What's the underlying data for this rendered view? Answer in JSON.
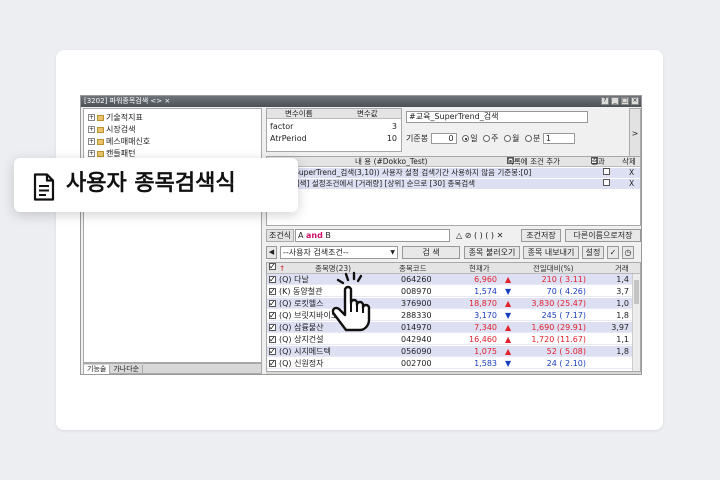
{
  "window": {
    "title": "[3202] 파워종목검색 <> ×"
  },
  "tree": [
    "기술적지표",
    "시장검색",
    "메스매매신호",
    "캔들패턴"
  ],
  "left_tabs": [
    "기능술",
    "가나다순"
  ],
  "variables": {
    "headers": [
      "변수이름",
      "변수값"
    ],
    "rows": [
      {
        "name": "factor",
        "value": "3"
      },
      {
        "name": "AtrPeriod",
        "value": "10"
      }
    ]
  },
  "formula_name": "#교육_SuperTrend_검색",
  "period": {
    "label": "기준봉",
    "value": "0",
    "options": [
      "일",
      "주",
      "월",
      "분"
    ],
    "selected": "일",
    "minute_value": "1"
  },
  "side_button": ">",
  "condition_grid": {
    "headers": [
      "내 용 (#Dokko_Test)",
      "목록에 조건 추가",
      "결과",
      "삭제"
    ],
    "rows": [
      {
        "text": "A 교육_SuperTrend_검색(3,10)) 사용자 설정 검색기간 사용하지 않음 기준봉:[0]",
        "del": "X"
      },
      {
        "text": "B 순위 검색] 설정조건에서 [거래량] [상위] 순으로 [30] 종목검색",
        "del": "X"
      }
    ]
  },
  "formula_row": {
    "label": "조건식",
    "parts": [
      "A",
      "and",
      "B"
    ],
    "symbols": "△ ⊘ ( ) ( ) ✕",
    "save_label": "조건저장",
    "save_as_label": "다른이름으로저장"
  },
  "search_row": {
    "dropdown": "--사용자 검색조건--",
    "search_label": "검  색",
    "load_label": "종목 불러오기",
    "export_label": "종목 내보내기",
    "settings_label": "설정"
  },
  "results": {
    "headers": [
      "종목명(23)",
      "종목코드",
      "현재가",
      "전일대비(%)",
      "거래"
    ],
    "rows": [
      {
        "name": "(Q) 다날",
        "code": "064260",
        "price": "6,960",
        "dir": "▲",
        "change": "210 ( 3.11)",
        "vol": "1,4",
        "color": "red"
      },
      {
        "name": "(K) 동양철관",
        "code": "008970",
        "price": "1,574",
        "dir": "▼",
        "change": "70 ( 4.26)",
        "vol": "3,7",
        "color": "blue"
      },
      {
        "name": "(Q) 로킷헬스",
        "code": "376900",
        "price": "18,870",
        "dir": "▲",
        "change": "3,830 (25.47)",
        "vol": "1,0",
        "color": "red"
      },
      {
        "name": "(Q) 브릿지바이오",
        "code": "288330",
        "price": "3,170",
        "dir": "▼",
        "change": "245 ( 7.17)",
        "vol": "1,8",
        "color": "blue"
      },
      {
        "name": "(Q) 삼륭물산",
        "code": "014970",
        "price": "7,340",
        "dir": "▲",
        "change": "1,690 (29.91)",
        "vol": "3,97",
        "color": "red"
      },
      {
        "name": "(Q) 상지건설",
        "code": "042940",
        "price": "16,460",
        "dir": "▲",
        "change": "1,720 (11.67)",
        "vol": "1,1",
        "color": "red"
      },
      {
        "name": "(Q) 시지메드텍",
        "code": "056090",
        "price": "1,075",
        "dir": "▲",
        "change": "52 ( 5.08)",
        "vol": "1,8",
        "color": "red"
      },
      {
        "name": "(Q) 신원정자",
        "code": "002700",
        "price": "1,583",
        "dir": "▼",
        "change": "24 ( 2.10)",
        "vol": "",
        "color": "blue"
      }
    ]
  },
  "callout": {
    "title": "사용자 종목검색식",
    "icon": "document-icon"
  },
  "pointer": {
    "icon": "hand-pointer-icon"
  }
}
